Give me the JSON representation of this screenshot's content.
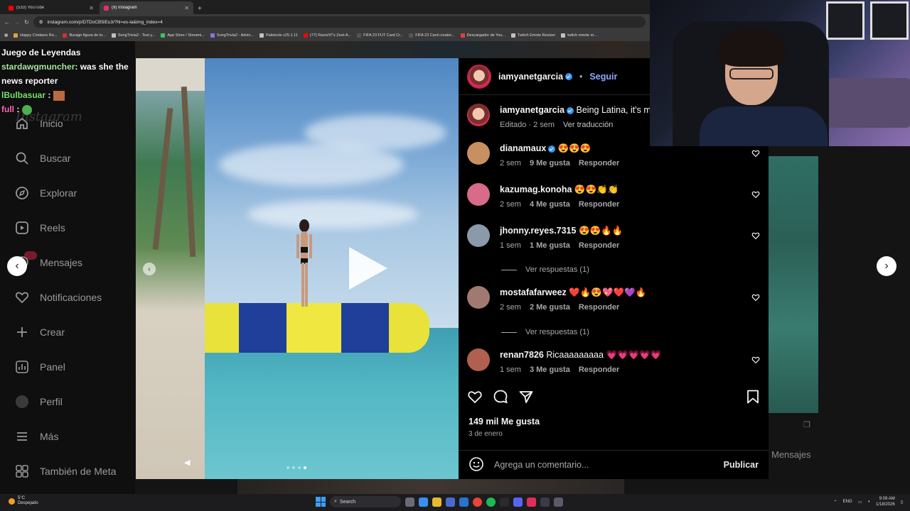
{
  "browser": {
    "tabs": [
      {
        "title": "(533) YouTube",
        "active": false,
        "color": "#ff0000"
      },
      {
        "title": "(9) Instagram",
        "active": true,
        "color": "#e1306c"
      }
    ],
    "url": "instagram.com/p/DTDoCB5lEu3/?hl=es-la&img_index=4",
    "bookmarks": [
      {
        "label": "Happy Cristiano Ro...",
        "color": "#e0a040"
      },
      {
        "label": "Burago figura de to...",
        "color": "#d03030"
      },
      {
        "label": "SongTrivia2 - Test y...",
        "color": "#c0c0c0"
      },
      {
        "label": "App Store / Streami...",
        "color": "#40c060"
      },
      {
        "label": "SongTrivia2 - Advin...",
        "color": "#9070e0"
      },
      {
        "label": "Paletools v25.1.11",
        "color": "#c0c0c0"
      },
      {
        "label": "(77) Razor97's Zest-A...",
        "color": "#ff0000"
      },
      {
        "label": "FIFA 23 FUT Card Cr...",
        "color": "#555555"
      },
      {
        "label": "FIFA 23 Card creator...",
        "color": "#555555"
      },
      {
        "label": "Descargador de You...",
        "color": "#e04040"
      },
      {
        "label": "Twitch Emote Resizer",
        "color": "#c0c0c0"
      },
      {
        "label": "twitch emote m...",
        "color": "#c0c0c0"
      }
    ]
  },
  "chat": [
    {
      "user": "Juego de Leyendas",
      "user_color": "#ffffff",
      "text": ""
    },
    {
      "user": "stardawgmuncher",
      "user_color": "#a8e6a1",
      "text": ": was she the news reporter"
    },
    {
      "user": "lBulbasuar",
      "user_color": "#7be36b",
      "text": " :"
    },
    {
      "user": "full",
      "user_color": "#ff69b4",
      "text": " :"
    }
  ],
  "sidebar": {
    "logo": "Instagram",
    "items": [
      {
        "label": "Inicio",
        "icon": "home-icon"
      },
      {
        "label": "Buscar",
        "icon": "search-icon"
      },
      {
        "label": "Explorar",
        "icon": "compass-icon"
      },
      {
        "label": "Reels",
        "icon": "reels-icon"
      },
      {
        "label": "Mensajes",
        "icon": "messenger-icon"
      },
      {
        "label": "Notificaciones",
        "icon": "heart-icon"
      },
      {
        "label": "Crear",
        "icon": "plus-icon"
      },
      {
        "label": "Panel",
        "icon": "chart-icon"
      },
      {
        "label": "Perfil",
        "icon": "profile-icon"
      },
      {
        "label": "Más",
        "icon": "menu-icon"
      },
      {
        "label": "También de Meta",
        "icon": "meta-icon"
      }
    ]
  },
  "post": {
    "author": "iamyanetgarcia",
    "follow": "Seguir",
    "separator": "•",
    "caption": "Being Latina, it's my",
    "caption_meta": "Editado · 2 sem",
    "translate": "Ver traducción",
    "likes": "149 mil Me gusta",
    "date": "3 de enero",
    "add_comment_placeholder": "Agrega un comentario...",
    "publish": "Publicar",
    "carousel_index": 4,
    "carousel_count": 4
  },
  "comments": [
    {
      "user": "dianamaux",
      "verified": true,
      "text": "😍😍😍",
      "time": "2 sem",
      "likes": "9 Me gusta",
      "reply": "Responder",
      "replies": "",
      "avatar_color": "#c89060"
    },
    {
      "user": "kazumag.konoha",
      "verified": false,
      "text": "😍😍👏👏",
      "time": "2 sem",
      "likes": "4 Me gusta",
      "reply": "Responder",
      "replies": "",
      "avatar_color": "#d86a8a"
    },
    {
      "user": "jhonny.reyes.7315",
      "verified": false,
      "text": "😍😍🔥🔥",
      "time": "1 sem",
      "likes": "1 Me gusta",
      "reply": "Responder",
      "replies": "Ver respuestas (1)",
      "avatar_color": "#8a9aaa"
    },
    {
      "user": "mostafafarweez",
      "verified": false,
      "text": "❤️🔥😍💖❤️💜🔥",
      "time": "2 sem",
      "likes": "2 Me gusta",
      "reply": "Responder",
      "replies": "Ver respuestas (1)",
      "avatar_color": "#a07a70"
    },
    {
      "user": "renan7826",
      "verified": false,
      "text": "Ricaaaaaaaaa 💗💗💗💗💗",
      "time": "1 sem",
      "likes": "3 Me gusta",
      "reply": "Responder",
      "replies": "",
      "avatar_color": "#b06050"
    }
  ],
  "right_page": {
    "messages_label": "Mensajes"
  },
  "taskbar": {
    "weather_temp": "5°C",
    "weather_desc": "Despejado",
    "search": "Search",
    "lang": "ENG",
    "time": "9:09 AM",
    "date": "1/18/2026"
  }
}
